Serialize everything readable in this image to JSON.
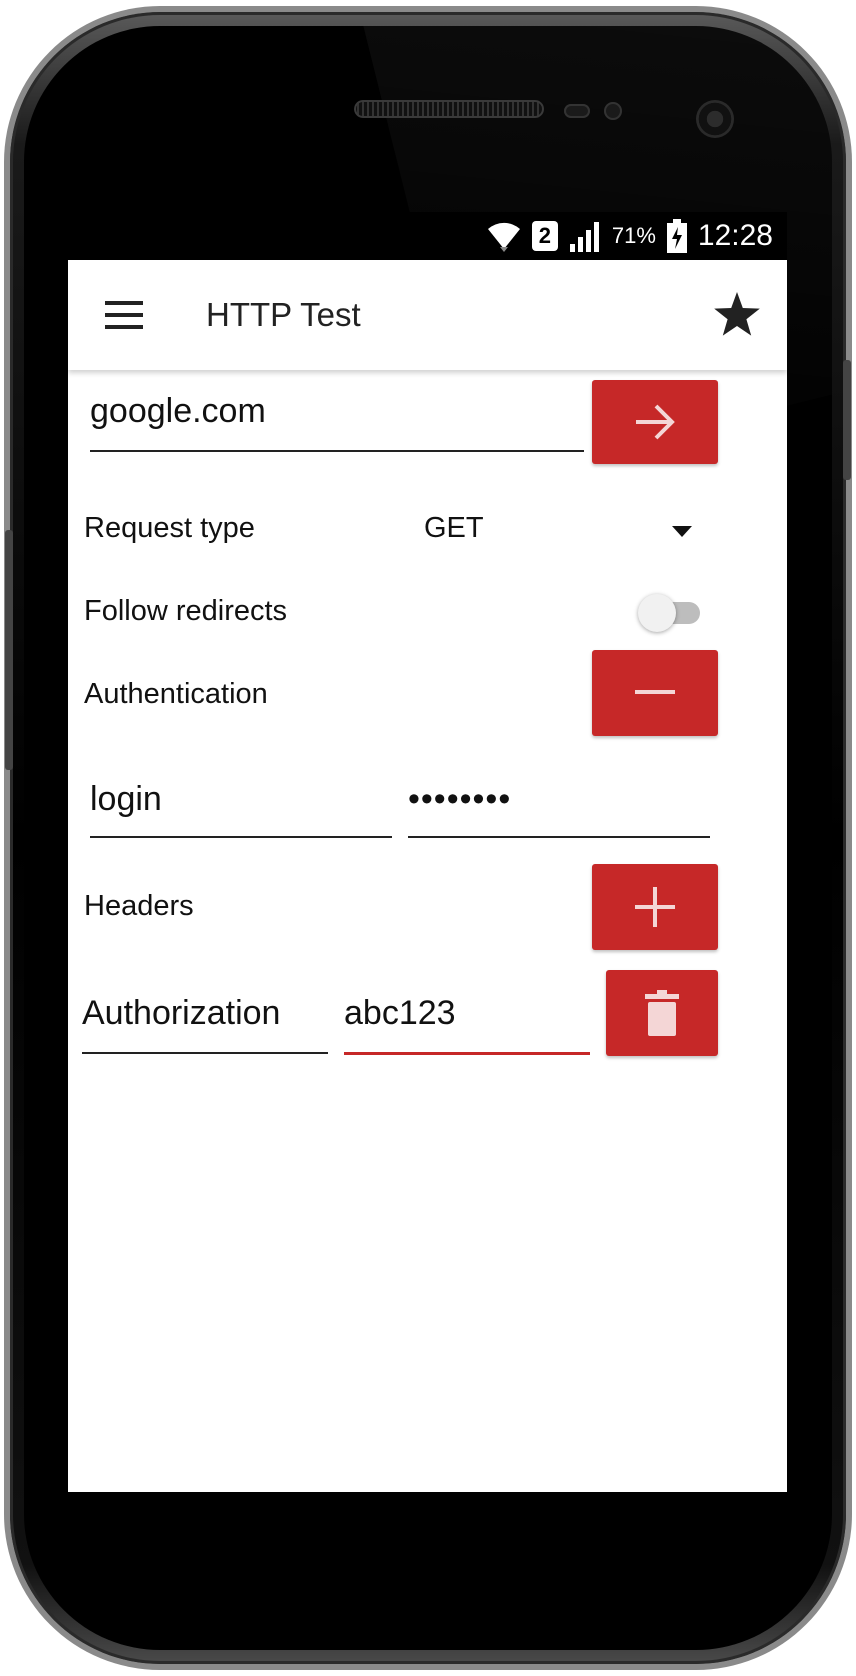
{
  "status_bar": {
    "battery_percent": "71%",
    "time": "12:28",
    "sim_badge": "2"
  },
  "app_bar": {
    "title": "HTTP Test",
    "menu_icon": "hamburger-menu-icon",
    "favorite_icon": "star-icon"
  },
  "url": {
    "value": "google.com",
    "go_icon": "arrow-right-icon"
  },
  "request_type": {
    "label": "Request type",
    "selected": "GET"
  },
  "follow_redirects": {
    "label": "Follow redirects",
    "enabled": false
  },
  "authentication": {
    "label": "Authentication",
    "toggle_icon": "minus-icon",
    "login_value": "login",
    "password_value": "••••••••"
  },
  "headers": {
    "label": "Headers",
    "add_icon": "plus-icon",
    "items": [
      {
        "name": "Authorization",
        "value": "abc123",
        "delete_icon": "trash-icon"
      }
    ]
  },
  "colors": {
    "accent": "#c62828",
    "text": "#111111",
    "background": "#ffffff"
  }
}
